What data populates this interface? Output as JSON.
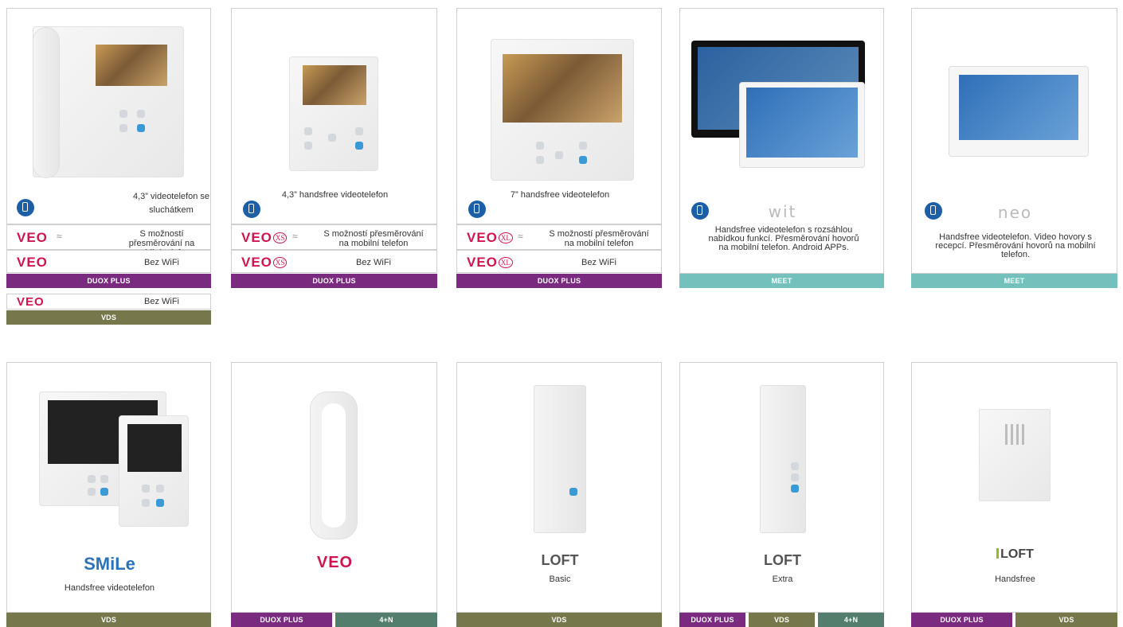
{
  "cards": {
    "c1": {
      "desc": "4,3” videotelefon se sluchátkem",
      "rows": [
        "S možností přesměrování na mobilní telefon",
        "Bez WiFi"
      ],
      "bar": "DUOX PLUS",
      "extra_row": "Bez WiFi",
      "extra_bar": "VDS"
    },
    "c2": {
      "desc": "4,3” handsfree videotelefon",
      "sfx": "XS",
      "rows": [
        "S možností přesměrování na mobilní telefon",
        "Bez WiFi"
      ],
      "bar": "DUOX PLUS"
    },
    "c3": {
      "desc": "7” handsfree videotelefon",
      "sfx": "XL",
      "rows": [
        "S možností přesměrování na mobilní telefon",
        "Bez WiFi"
      ],
      "bar": "DUOX PLUS"
    },
    "c4": {
      "brand": "wit",
      "desc": "Handsfree videotelefon s rozsáhlou nabídkou funkcí. Přesměrování hovorů na mobilní telefon. Android APPs.",
      "bar": "MEET"
    },
    "c5": {
      "brand": "neo",
      "desc": "Handsfree videotelefon. Video hovory s recepcí. Přesměrování hovorů na mobilní telefon.",
      "bar": "MEET"
    },
    "c6": {
      "brand": "SMiLe",
      "desc": "Handsfree videotelefon",
      "bar": "VDS"
    },
    "c7": {
      "brand": "VEO",
      "bars": [
        "DUOX PLUS",
        "4+N"
      ]
    },
    "c8": {
      "brand": "LOFT",
      "sub": "Basic",
      "bar": "VDS"
    },
    "c9": {
      "brand": "LOFT",
      "sub": "Extra",
      "bars": [
        "DUOX PLUS",
        "VDS",
        "4+N"
      ]
    },
    "c10": {
      "brand": "LOFT",
      "sub": "Handsfree",
      "bars": [
        "DUOX PLUS",
        "VDS"
      ]
    }
  },
  "veo_label": "VEO",
  "colors": {
    "purple": "#7a2a7f",
    "olive": "#76774a",
    "teal": "#73c0bd",
    "dark_teal": "#537d6c",
    "veo_red": "#d0154e",
    "mobile_blue": "#1c5fa6"
  }
}
